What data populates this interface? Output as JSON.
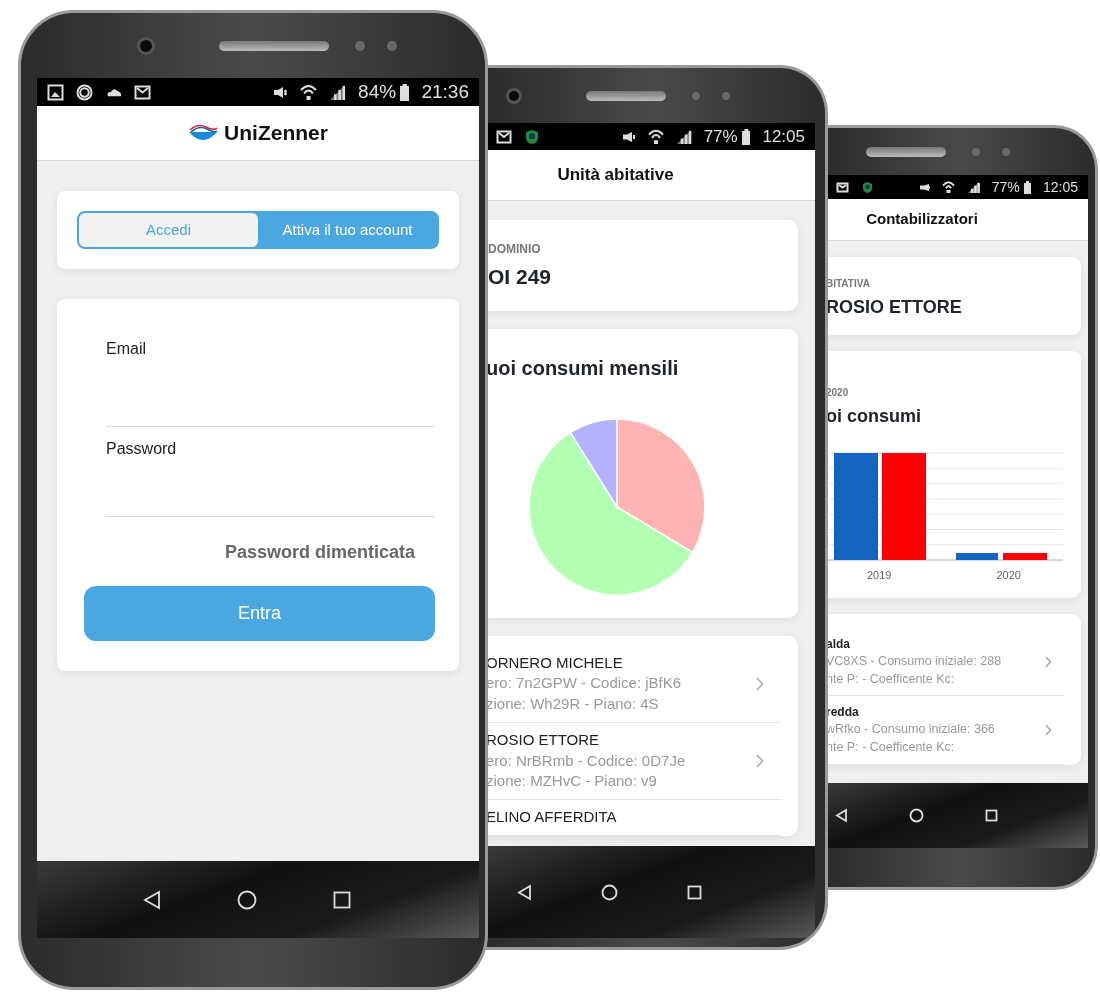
{
  "phones": [
    {
      "kind": "login",
      "status_bar": {
        "battery": "84%",
        "time": "21:36"
      },
      "header": {
        "logo_text": "UniZenner"
      },
      "tabs": [
        {
          "label": "Accedi",
          "selected": true
        },
        {
          "label": "Attiva il tuo account",
          "selected": false
        }
      ],
      "fields": [
        {
          "label": "Email"
        },
        {
          "label": "Password"
        }
      ],
      "forgot_link": "Password dimenticata",
      "submit_button": "Entra"
    },
    {
      "kind": "units",
      "status_bar": {
        "battery": "77%",
        "time": "12:05"
      },
      "title": "Unità abitative",
      "info_card": {
        "caption": "DOMINIO",
        "value": "OI 249"
      },
      "chart_card": {
        "title": "uoi consumi mensili"
      },
      "list": [
        {
          "title": "ORNERO MICHELE",
          "line_1": "ero: 7n2GPW - Codice: jBfK6",
          "line_2": "zione: Wh29R - Piano: 4S"
        },
        {
          "title": "ROSIO ETTORE",
          "line_1": "ero: NrBRmb - Codice: 0D7Je",
          "line_2": "zione: MZHvC - Piano: v9"
        },
        {
          "title": "ELINO AFFERDITA"
        }
      ]
    },
    {
      "kind": "meters",
      "status_bar": {
        "battery": "77%",
        "time": "12:05"
      },
      "title": "Contabilizzatori",
      "info_card": {
        "caption": "BITATIVA",
        "value": "ROSIO ETTORE"
      },
      "chart_card": {
        "caption": "2020",
        "title": "oi consumi",
        "x_labels": [
          "2019",
          "2020"
        ]
      },
      "list": [
        {
          "title": "alda",
          "line_1": "VC8XS - Consumo iniziale: 288",
          "line_2": "nte P: - Coefficente Kc:"
        },
        {
          "title": "redda",
          "line_1": "wRfko - Consumo iniziale: 366",
          "line_2": "nte P: - Coefficente Kc:"
        }
      ]
    }
  ]
}
